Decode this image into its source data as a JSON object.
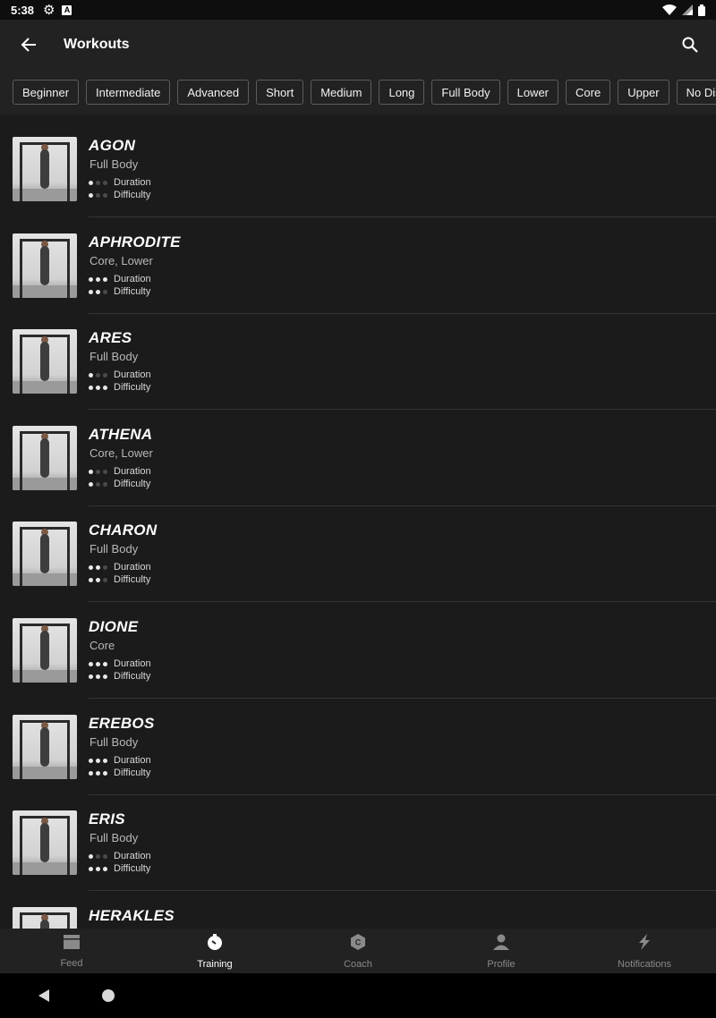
{
  "status_bar": {
    "time": "5:38",
    "badge": "A"
  },
  "app_bar": {
    "title": "Workouts"
  },
  "filters": [
    "Beginner",
    "Intermediate",
    "Advanced",
    "Short",
    "Medium",
    "Long",
    "Full Body",
    "Lower",
    "Core",
    "Upper",
    "No Distance"
  ],
  "labels": {
    "duration": "Duration",
    "difficulty": "Difficulty"
  },
  "workouts": [
    {
      "name": "AGON",
      "category": "Full Body",
      "duration": 1,
      "difficulty": 1
    },
    {
      "name": "APHRODITE",
      "category": "Core, Lower",
      "duration": 3,
      "difficulty": 2
    },
    {
      "name": "ARES",
      "category": "Full Body",
      "duration": 1,
      "difficulty": 3
    },
    {
      "name": "ATHENA",
      "category": "Core, Lower",
      "duration": 1,
      "difficulty": 1
    },
    {
      "name": "CHARON",
      "category": "Full Body",
      "duration": 2,
      "difficulty": 2
    },
    {
      "name": "DIONE",
      "category": "Core",
      "duration": 3,
      "difficulty": 3
    },
    {
      "name": "EREBOS",
      "category": "Full Body",
      "duration": 3,
      "difficulty": 3
    },
    {
      "name": "ERIS",
      "category": "Full Body",
      "duration": 1,
      "difficulty": 3
    },
    {
      "name": "HERAKLES",
      "category": "",
      "duration": 0,
      "difficulty": 0
    }
  ],
  "dot_max": 3,
  "bottom_nav": [
    {
      "label": "Feed",
      "icon": "feed-icon",
      "active": false
    },
    {
      "label": "Training",
      "icon": "training-icon",
      "active": true
    },
    {
      "label": "Coach",
      "icon": "coach-icon",
      "active": false
    },
    {
      "label": "Profile",
      "icon": "profile-icon",
      "active": false
    },
    {
      "label": "Notifications",
      "icon": "notifications-icon",
      "active": false
    }
  ],
  "colors": {
    "background": "#1b1b1c",
    "bar": "#222223",
    "chip_border": "#5c5c5c",
    "dot_on": "#e8e8e8",
    "dot_off": "#4a4a4a"
  }
}
